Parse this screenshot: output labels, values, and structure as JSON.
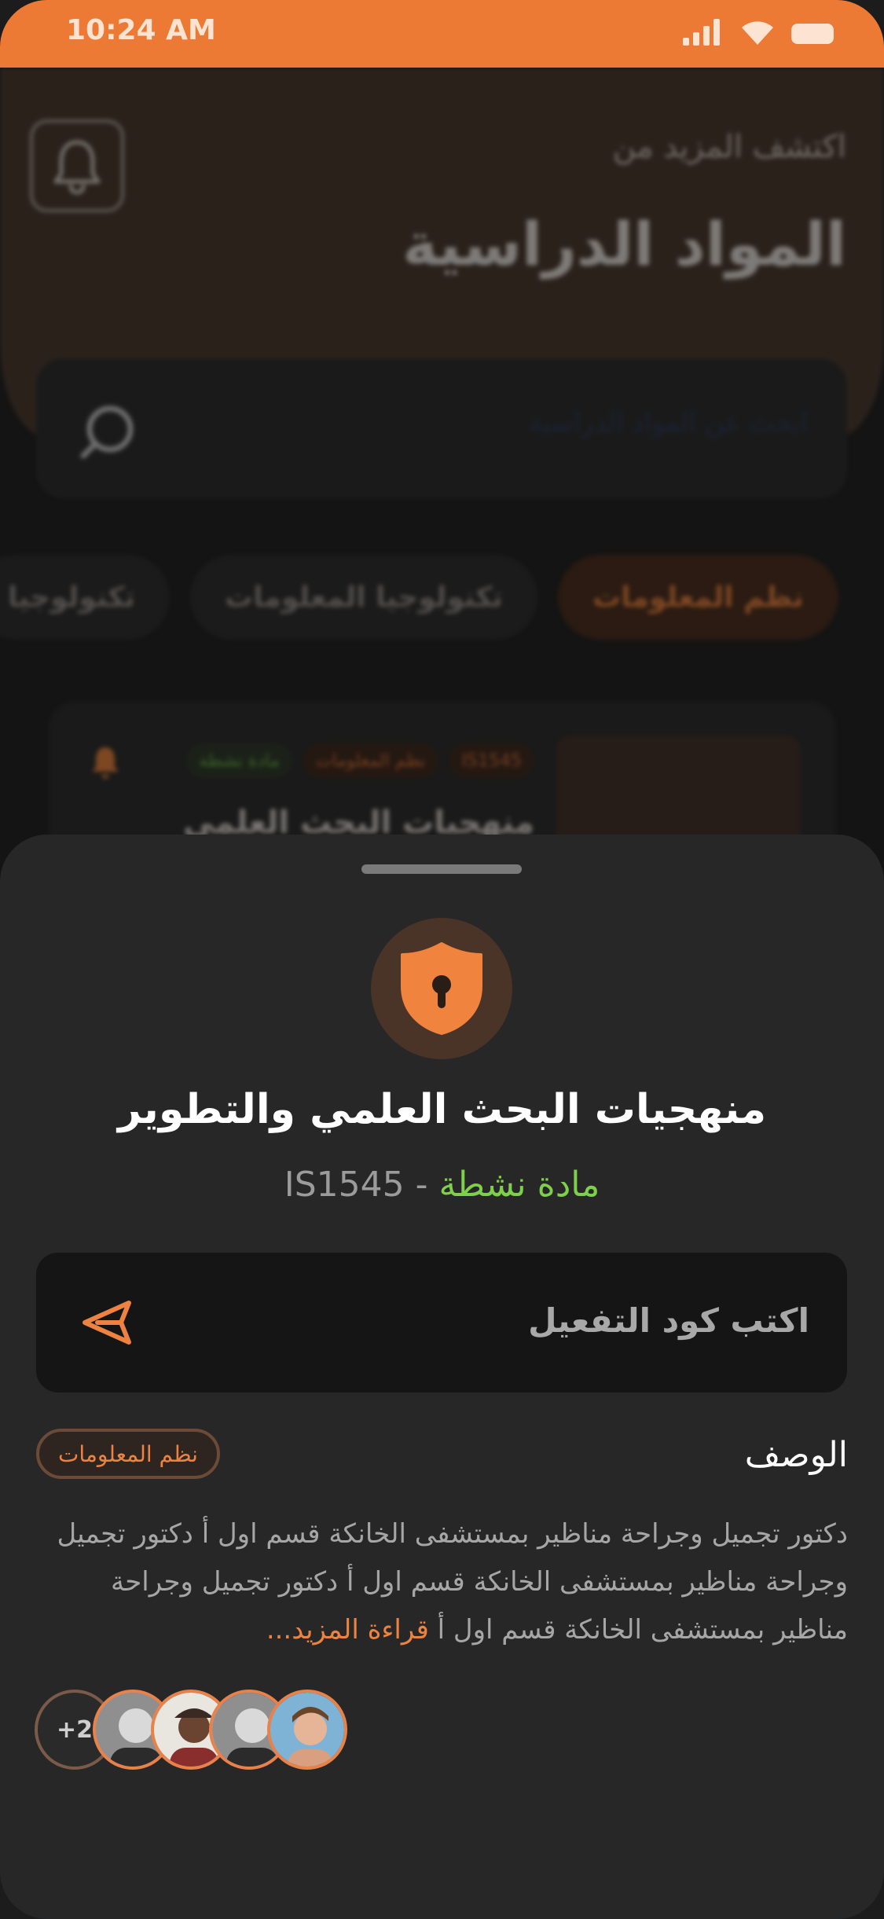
{
  "status_bar": {
    "time": "10:24 AM"
  },
  "header": {
    "subtitle": "اكتشف المزيد من",
    "title": "المواد الدراسية",
    "search_placeholder": "ابحث عن المواد الدراسية"
  },
  "filters": [
    {
      "label": "نظم المعلومات",
      "active": true
    },
    {
      "label": "تكنولوجيا المعلومات",
      "active": false
    },
    {
      "label": "تكنولوجيا",
      "active": false
    }
  ],
  "bg_card": {
    "code": "IS1545",
    "category": "نظم المعلومات",
    "status": "مادة نشطة",
    "title": "منهجيات البحث العلمي"
  },
  "sheet": {
    "title": "منهجيات البحث العلمي والتطوير",
    "status": "مادة نشطة",
    "separator": " - ",
    "code": "IS1545",
    "code_placeholder": "اكتب كود التفعيل",
    "desc_label": "الوصف",
    "category_chip": "نظم المعلومات",
    "description": "دكتور تجميل وجراحة مناظير بمستشفى الخانكة قسم اول أ دكتور تجميل وجراحة مناظير بمستشفى الخانكة قسم اول أ دكتور تجميل وجراحة مناظير بمستشفى الخانكة قسم اول أ",
    "read_more": "قراءة المزيد...",
    "more_count": "+2"
  },
  "colors": {
    "accent": "#ec7a34",
    "active_green": "#7ed04a",
    "sheet_bg": "#272727"
  }
}
